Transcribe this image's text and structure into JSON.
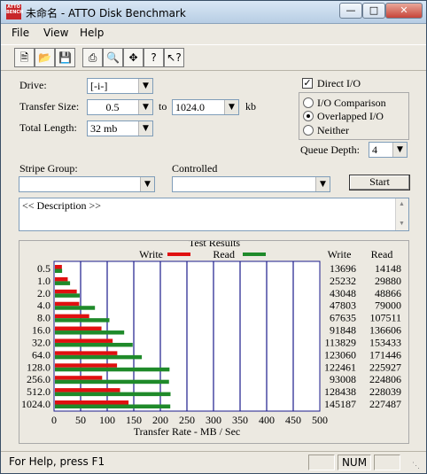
{
  "window": {
    "title": "未命名 - ATTO Disk Benchmark",
    "icon_text": "ATTO BENCH"
  },
  "menu": [
    "File",
    "View",
    "Help"
  ],
  "toolbar": {
    "icons": [
      "new-file-icon",
      "open-folder-icon",
      "save-icon",
      "print-icon",
      "print-preview-icon",
      "move-icon",
      "help-icon",
      "context-help-icon"
    ]
  },
  "settings": {
    "drive_label": "Drive:",
    "drive_value": "[-i-]",
    "transfer_size_label": "Transfer Size:",
    "transfer_from": "0.5",
    "to_label": "to",
    "transfer_to": "1024.0",
    "kb_label": "kb",
    "total_length_label": "Total Length:",
    "total_length_value": "32 mb",
    "direct_io_label": "Direct I/O",
    "direct_io_checked": true,
    "io_modes": [
      {
        "label": "I/O Comparison",
        "selected": false
      },
      {
        "label": "Overlapped I/O",
        "selected": true
      },
      {
        "label": "Neither",
        "selected": false
      }
    ],
    "queue_depth_label": "Queue Depth:",
    "queue_depth_value": "4",
    "stripe_group_label": "Stripe Group:",
    "stripe_group_value": "",
    "controlled_label": "Controlled",
    "controlled_value": "",
    "start_label": "Start",
    "description": "<< Description >>"
  },
  "results": {
    "title": "Test Results",
    "write_legend": "Write",
    "read_legend": "Read",
    "write_header": "Write",
    "read_header": "Read",
    "write_color": "#e01010",
    "read_color": "#1f8a2a",
    "grid_color": "#1b1b8c"
  },
  "chart_data": {
    "type": "bar",
    "orientation": "horizontal",
    "title": "Test Results",
    "xlabel": "Transfer Rate - MB / Sec",
    "xlim": [
      0,
      500
    ],
    "xticks": [
      "0",
      "50",
      "100",
      "150",
      "200",
      "250",
      "300",
      "350",
      "400",
      "450",
      "500"
    ],
    "categories": [
      "0.5",
      "1.0",
      "2.0",
      "4.0",
      "8.0",
      "16.0",
      "32.0",
      "64.0",
      "128.0",
      "256.0",
      "512.0",
      "1024.0"
    ],
    "series": [
      {
        "name": "Write",
        "values": [
          13.1,
          24.1,
          41.1,
          45.6,
          64.5,
          87.6,
          108.6,
          117.3,
          116.8,
          88.8,
          122.5,
          138.5
        ],
        "labels": [
          "13696",
          "25232",
          "43048",
          "47803",
          "67635",
          "91848",
          "113829",
          "123060",
          "122461",
          "93008",
          "128438",
          "145187"
        ]
      },
      {
        "name": "Read",
        "values": [
          13.5,
          28.5,
          46.6,
          75.3,
          102.5,
          130.3,
          146.3,
          163.5,
          215.6,
          214.6,
          217.5,
          217.0
        ],
        "labels": [
          "14148",
          "29880",
          "48866",
          "79000",
          "107511",
          "136606",
          "153433",
          "171446",
          "225927",
          "224806",
          "228039",
          "227487"
        ]
      }
    ],
    "grid": true,
    "legend": "top"
  },
  "status": {
    "text": "For Help, press F1",
    "num": "NUM"
  }
}
